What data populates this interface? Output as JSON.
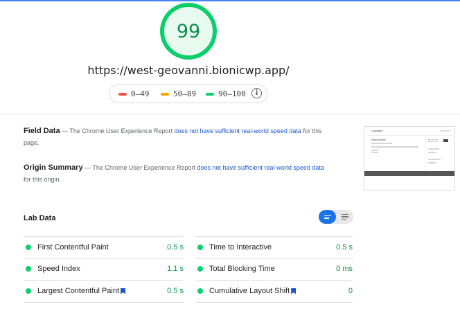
{
  "score": {
    "value": "99",
    "color": "#0cce6b"
  },
  "url": "https://west-geovanni.bionicwp.app/",
  "legend": [
    {
      "label": "0–49",
      "color": "#ff4e42"
    },
    {
      "label": "50–89",
      "color": "#ffa400"
    },
    {
      "label": "90–100",
      "color": "#0cce6b"
    }
  ],
  "field_data": {
    "title": "Field Data",
    "text_before": " — The Chrome User Experience Report ",
    "link": "does not have sufficient real-world speed data",
    "text_after": " for this page."
  },
  "origin_summary": {
    "title": "Origin Summary",
    "text_before": " — The Chrome User Experience Report ",
    "link": "does not have sufficient real-world speed data",
    "text_after": " for this origin."
  },
  "lab_data": {
    "title": "Lab Data",
    "metrics_left": [
      {
        "label": "First Contentful Paint",
        "value": "0.5 s",
        "bookmark": false
      },
      {
        "label": "Speed Index",
        "value": "1.1 s",
        "bookmark": false
      },
      {
        "label": "Largest Contentful Paint",
        "value": "0.5 s",
        "bookmark": true
      }
    ],
    "metrics_right": [
      {
        "label": "Time to Interactive",
        "value": "0.5 s",
        "bookmark": false
      },
      {
        "label": "Total Blocking Time",
        "value": "0 ms",
        "bookmark": false
      },
      {
        "label": "Cumulative Layout Shift",
        "value": "0",
        "bookmark": true
      }
    ]
  },
  "thumbnail": {
    "site_name": "Logotype",
    "heading": "Hello world!"
  }
}
